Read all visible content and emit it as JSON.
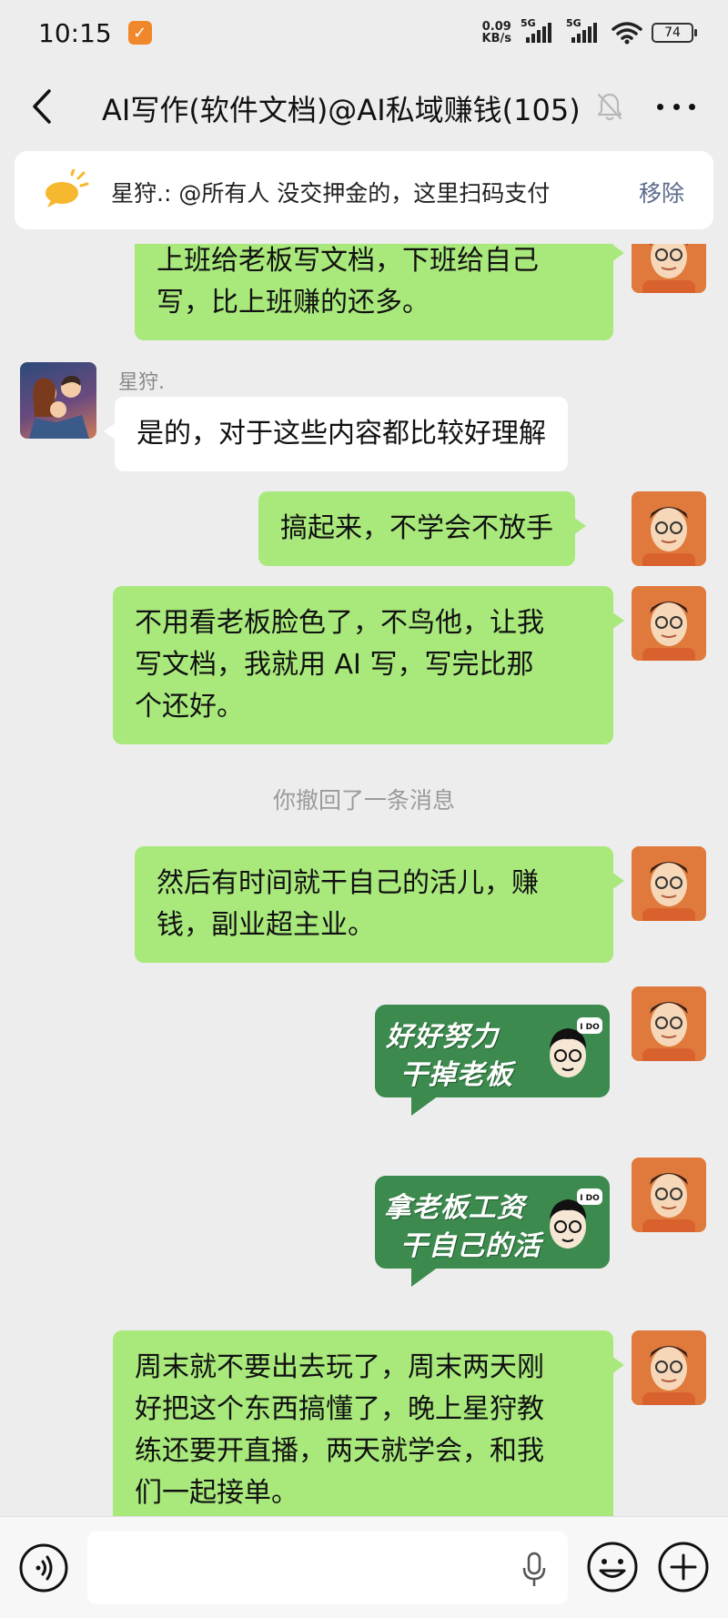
{
  "status_bar": {
    "time": "10:15",
    "net_speed_top": "0.09",
    "net_speed_bottom": "KB/s",
    "sim1_label": "5G",
    "sim2_label": "5G",
    "battery": "74"
  },
  "header": {
    "title": "AI写作(软件文档)@AI私域赚钱(105)"
  },
  "pinned": {
    "text": "星狩.: @所有人 没交押金的，这里扫码支付",
    "remove_label": "移除"
  },
  "messages": [
    {
      "side": "right",
      "lines": [
        "上班给老板写文档，下班给自己",
        "写，比上班赚的还多。"
      ]
    },
    {
      "side": "left",
      "sender": "星狩.",
      "lines": [
        "是的，对于这些内容都比较好理解"
      ]
    },
    {
      "side": "right",
      "lines": [
        "搞起来，不学会不放手"
      ]
    },
    {
      "side": "right",
      "lines": [
        "不用看老板脸色了，不鸟他，让我",
        "写文档，我就用 AI 写，写完比那",
        "个还好。"
      ]
    },
    {
      "side": "right",
      "lines": [
        "然后有时间就干自己的活儿，赚",
        "钱，副业超主业。"
      ]
    },
    {
      "side": "right",
      "lines": [
        "周末就不要出去玩了，周末两天刚",
        "好把这个东西搞懂了，晚上星狩教",
        "练还要开直播，两天就学会，和我",
        "们一起接单。"
      ]
    }
  ],
  "system_message": "你撤回了一条消息",
  "stickers": [
    {
      "line1": "好好努力",
      "line2": "干掉老板",
      "tag": "I DO"
    },
    {
      "line1": "拿老板工资",
      "line2": "干自己的活",
      "tag": "I DO"
    }
  ],
  "colors": {
    "my_bubble": "#a9e97c",
    "other_bubble": "#ffffff",
    "background": "#ededed",
    "sticker_bg": "#3d8a4e",
    "avatar_orange": "#e0793c"
  },
  "icons": {
    "back": "chevron-left-icon",
    "mute": "bell-off-icon",
    "more": "more-dots-icon",
    "pin": "megaphone-icon",
    "voice": "voice-wave-icon",
    "mic": "microphone-icon",
    "emoji": "emoji-icon",
    "plus": "plus-circle-icon"
  }
}
